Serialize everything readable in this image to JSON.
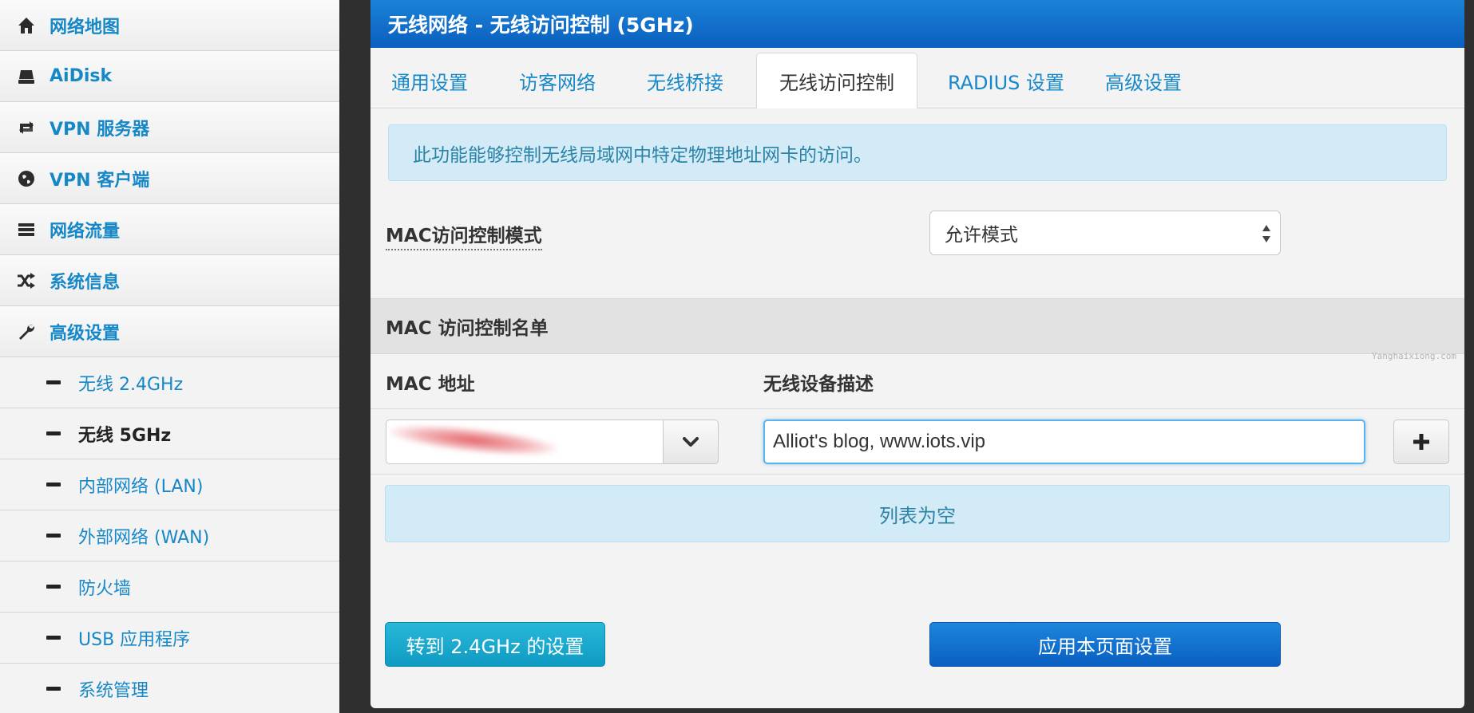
{
  "sidebar": {
    "items": [
      {
        "label": "网络地图",
        "icon": "home-icon"
      },
      {
        "label": "AiDisk",
        "icon": "disk-icon"
      },
      {
        "label": "VPN 服务器",
        "icon": "retweet-icon"
      },
      {
        "label": "VPN 客户端",
        "icon": "globe-icon"
      },
      {
        "label": "网络流量",
        "icon": "list-icon"
      },
      {
        "label": "系统信息",
        "icon": "shuffle-icon"
      },
      {
        "label": "高级设置",
        "icon": "wrench-icon"
      }
    ],
    "subitems": [
      {
        "label": "无线 2.4GHz"
      },
      {
        "label": "无线 5GHz"
      },
      {
        "label": "内部网络 (LAN)"
      },
      {
        "label": "外部网络 (WAN)"
      },
      {
        "label": "防火墙"
      },
      {
        "label": "USB 应用程序"
      },
      {
        "label": "系统管理"
      }
    ],
    "active_subitem": "无线 5GHz"
  },
  "panel": {
    "title": "无线网络 - 无线访问控制 (5GHz)",
    "tabs": [
      {
        "label": "通用设置"
      },
      {
        "label": "访客网络"
      },
      {
        "label": "无线桥接"
      },
      {
        "label": "无线访问控制"
      },
      {
        "label": "RADIUS 设置"
      },
      {
        "label": "高级设置"
      }
    ],
    "active_tab": "无线访问控制",
    "info_text": "此功能能够控制无线局域网中特定物理地址网卡的访问。",
    "mode_label": "MAC访问控制模式",
    "mode_value": "允许模式",
    "section_title": "MAC 访问控制名单",
    "watermark": "Yanghaixiong.com",
    "columns": {
      "mac": "MAC 地址",
      "desc": "无线设备描述"
    },
    "desc_value": "Alliot's blog, www.iots.vip",
    "empty_text": "列表为空",
    "goto_button": "转到 2.4GHz 的设置",
    "apply_button": "应用本页面设置"
  },
  "colors": {
    "header_blue": "#0b5fbf",
    "link_blue": "#1688c8",
    "info_bg": "#d3ebf6",
    "cyan_button": "#1aa8cd"
  }
}
